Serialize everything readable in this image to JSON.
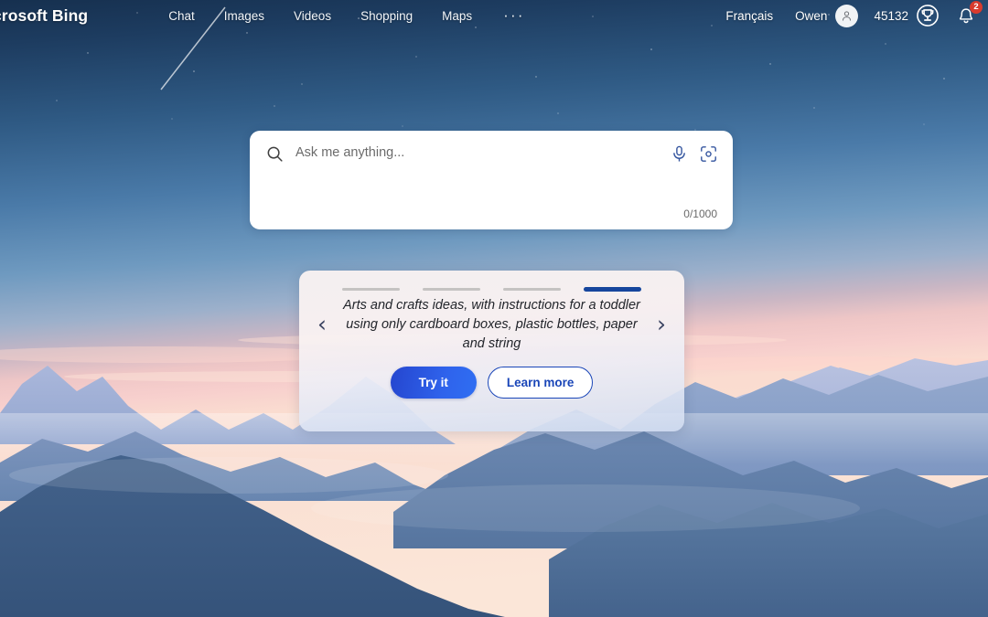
{
  "brand": {
    "label": "icrosoft Bing",
    "full": "Microsoft Bing"
  },
  "nav": {
    "items": [
      {
        "label": "Chat",
        "name": "nav-chat"
      },
      {
        "label": "Images",
        "name": "nav-images"
      },
      {
        "label": "Videos",
        "name": "nav-videos"
      },
      {
        "label": "Shopping",
        "name": "nav-shopping"
      },
      {
        "label": "Maps",
        "name": "nav-maps"
      }
    ],
    "more_label": "···"
  },
  "account": {
    "language": "Français",
    "user_name": "Owen",
    "points": "45132",
    "notification_count": "2",
    "avatar_icon": "person-icon",
    "rewards_icon": "trophy-icon",
    "bell_icon": "bell-icon"
  },
  "search": {
    "placeholder": "Ask me anything...",
    "value": "",
    "char_counter": "0/1000",
    "magnifier_icon": "search-icon",
    "mic_icon": "microphone-icon",
    "lens_icon": "visual-search-icon"
  },
  "carousel": {
    "prev_label": "‹",
    "next_label": "›",
    "slides_total": 4,
    "active_index": 3,
    "promo_text": "Arts and crafts ideas, with instructions for a toddler using only cardboard boxes, plastic bottles, paper and string",
    "try_label": "Try it",
    "learn_label": "Learn more"
  },
  "colors": {
    "accent_blue": "#2f63ec",
    "active_dash": "#16469d",
    "badge_red": "#d83b2e",
    "sky_top": "#1f3a5f",
    "sky_mid": "#5b8ab8",
    "sunset_pink": "#f6cfd3",
    "mountain_dark": "#3d5a7a"
  }
}
